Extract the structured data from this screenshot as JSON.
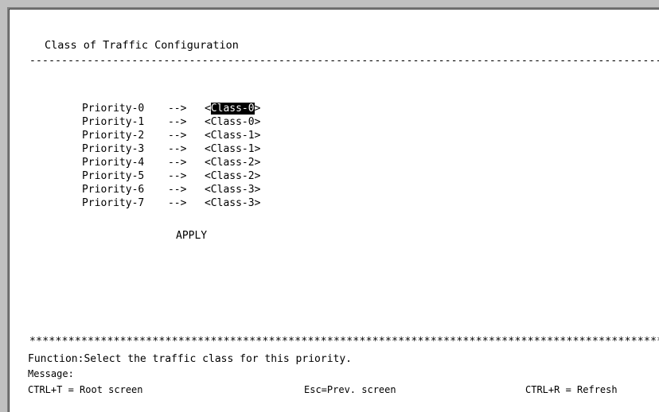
{
  "screen": {
    "title": "Class of Traffic Configuration",
    "separator": "------------------------------------------------------------------------------------------------------",
    "priorities": [
      {
        "label": "Priority-0",
        "arrow": "-->",
        "open": "<",
        "value": "Class-0",
        "close": ">",
        "selected": true
      },
      {
        "label": "Priority-1",
        "arrow": "-->",
        "open": "<",
        "value": "Class-0",
        "close": ">",
        "selected": false
      },
      {
        "label": "Priority-2",
        "arrow": "-->",
        "open": "<",
        "value": "Class-1",
        "close": ">",
        "selected": false
      },
      {
        "label": "Priority-3",
        "arrow": "-->",
        "open": "<",
        "value": "Class-1",
        "close": ">",
        "selected": false
      },
      {
        "label": "Priority-4",
        "arrow": "-->",
        "open": "<",
        "value": "Class-2",
        "close": ">",
        "selected": false
      },
      {
        "label": "Priority-5",
        "arrow": "-->",
        "open": "<",
        "value": "Class-2",
        "close": ">",
        "selected": false
      },
      {
        "label": "Priority-6",
        "arrow": "-->",
        "open": "<",
        "value": "Class-3",
        "close": ">",
        "selected": false
      },
      {
        "label": "Priority-7",
        "arrow": "-->",
        "open": "<",
        "value": "Class-3",
        "close": ">",
        "selected": false
      }
    ],
    "apply_label": "APPLY"
  },
  "footer": {
    "stars": "***************************************************************************************************",
    "function_prefix": "Function:",
    "function_text": "Select the traffic class for this priority.",
    "message_label": "Message:",
    "message_text": "",
    "keys": [
      {
        "label": "CTRL+T = Root screen"
      },
      {
        "label": "Esc=Prev. screen"
      },
      {
        "label": "CTRL+R = Refresh"
      }
    ]
  }
}
